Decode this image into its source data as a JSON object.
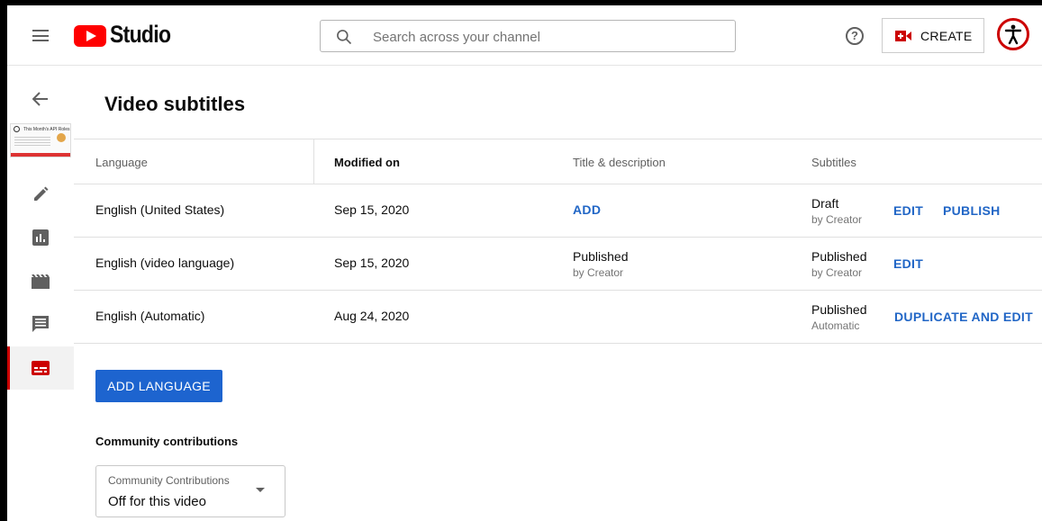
{
  "app": {
    "logo_text": "Studio",
    "search_placeholder": "Search across your channel",
    "help_glyph": "?",
    "create_label": "CREATE"
  },
  "sidebar": {
    "icons": [
      "back-arrow-icon",
      "edit-pencil-icon",
      "analytics-icon",
      "editor-clapper-icon",
      "comments-icon",
      "subtitles-icon"
    ],
    "thumbnail_title": "This Month's API Roles",
    "active_item": "subtitles"
  },
  "page": {
    "title": "Video subtitles"
  },
  "table": {
    "headers": {
      "language": "Language",
      "modified": "Modified on",
      "title_desc": "Title & description",
      "subtitles": "Subtitles"
    },
    "rows": [
      {
        "language": "English (United States)",
        "modified": "Sep 15, 2020",
        "title_action": "ADD",
        "sub_status": "Draft",
        "sub_by": "by Creator",
        "action1": "EDIT",
        "action2": "PUBLISH"
      },
      {
        "language": "English (video language)",
        "modified": "Sep 15, 2020",
        "title_status": "Published",
        "title_by": "by Creator",
        "sub_status": "Published",
        "sub_by": "by Creator",
        "action1": "EDIT"
      },
      {
        "language": "English (Automatic)",
        "modified": "Aug 24, 2020",
        "sub_status": "Published",
        "sub_by": "Automatic",
        "action1": "DUPLICATE AND EDIT"
      }
    ]
  },
  "add_language_label": "ADD LANGUAGE",
  "community": {
    "heading": "Community contributions",
    "select_label": "Community Contributions",
    "select_value": "Off for this video"
  },
  "colors": {
    "brand_red": "#ff0000",
    "link_blue": "#2166c6",
    "button_blue": "#1d64cf",
    "accent_red": "#cc0000"
  }
}
